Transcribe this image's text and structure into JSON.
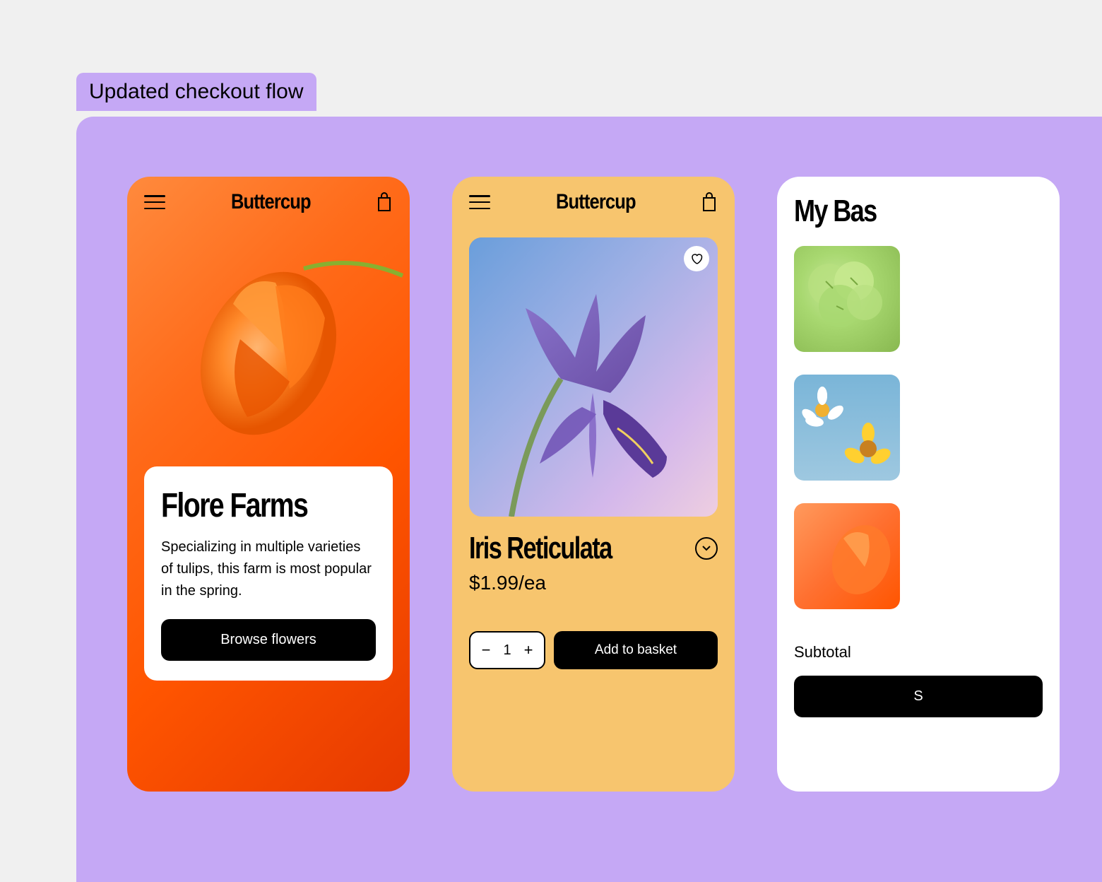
{
  "frame_label": "Updated checkout flow",
  "screens": {
    "home": {
      "brand": "Buttercup",
      "hero_title": "Flore Farms",
      "hero_description": "Specializing in multiple varieties of tulips, this farm is most popular in the spring.",
      "cta_label": "Browse flowers"
    },
    "product": {
      "brand": "Buttercup",
      "product_name": "Iris Reticulata",
      "price": "$1.99/ea",
      "quantity": "1",
      "add_label": "Add to basket"
    },
    "basket": {
      "title": "My Bas",
      "subtotal_label": "Subtotal",
      "checkout_prefix": "S"
    }
  }
}
